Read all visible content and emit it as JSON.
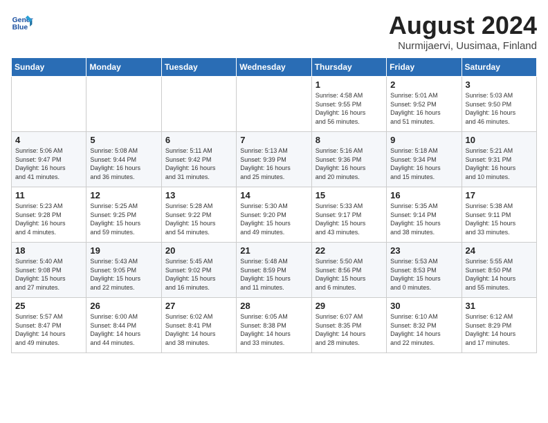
{
  "header": {
    "logo_line1": "General",
    "logo_line2": "Blue",
    "month": "August 2024",
    "location": "Nurmijaervi, Uusimaa, Finland"
  },
  "weekdays": [
    "Sunday",
    "Monday",
    "Tuesday",
    "Wednesday",
    "Thursday",
    "Friday",
    "Saturday"
  ],
  "weeks": [
    [
      {
        "day": "",
        "info": ""
      },
      {
        "day": "",
        "info": ""
      },
      {
        "day": "",
        "info": ""
      },
      {
        "day": "",
        "info": ""
      },
      {
        "day": "1",
        "info": "Sunrise: 4:58 AM\nSunset: 9:55 PM\nDaylight: 16 hours\nand 56 minutes."
      },
      {
        "day": "2",
        "info": "Sunrise: 5:01 AM\nSunset: 9:52 PM\nDaylight: 16 hours\nand 51 minutes."
      },
      {
        "day": "3",
        "info": "Sunrise: 5:03 AM\nSunset: 9:50 PM\nDaylight: 16 hours\nand 46 minutes."
      }
    ],
    [
      {
        "day": "4",
        "info": "Sunrise: 5:06 AM\nSunset: 9:47 PM\nDaylight: 16 hours\nand 41 minutes."
      },
      {
        "day": "5",
        "info": "Sunrise: 5:08 AM\nSunset: 9:44 PM\nDaylight: 16 hours\nand 36 minutes."
      },
      {
        "day": "6",
        "info": "Sunrise: 5:11 AM\nSunset: 9:42 PM\nDaylight: 16 hours\nand 31 minutes."
      },
      {
        "day": "7",
        "info": "Sunrise: 5:13 AM\nSunset: 9:39 PM\nDaylight: 16 hours\nand 25 minutes."
      },
      {
        "day": "8",
        "info": "Sunrise: 5:16 AM\nSunset: 9:36 PM\nDaylight: 16 hours\nand 20 minutes."
      },
      {
        "day": "9",
        "info": "Sunrise: 5:18 AM\nSunset: 9:34 PM\nDaylight: 16 hours\nand 15 minutes."
      },
      {
        "day": "10",
        "info": "Sunrise: 5:21 AM\nSunset: 9:31 PM\nDaylight: 16 hours\nand 10 minutes."
      }
    ],
    [
      {
        "day": "11",
        "info": "Sunrise: 5:23 AM\nSunset: 9:28 PM\nDaylight: 16 hours\nand 4 minutes."
      },
      {
        "day": "12",
        "info": "Sunrise: 5:25 AM\nSunset: 9:25 PM\nDaylight: 15 hours\nand 59 minutes."
      },
      {
        "day": "13",
        "info": "Sunrise: 5:28 AM\nSunset: 9:22 PM\nDaylight: 15 hours\nand 54 minutes."
      },
      {
        "day": "14",
        "info": "Sunrise: 5:30 AM\nSunset: 9:20 PM\nDaylight: 15 hours\nand 49 minutes."
      },
      {
        "day": "15",
        "info": "Sunrise: 5:33 AM\nSunset: 9:17 PM\nDaylight: 15 hours\nand 43 minutes."
      },
      {
        "day": "16",
        "info": "Sunrise: 5:35 AM\nSunset: 9:14 PM\nDaylight: 15 hours\nand 38 minutes."
      },
      {
        "day": "17",
        "info": "Sunrise: 5:38 AM\nSunset: 9:11 PM\nDaylight: 15 hours\nand 33 minutes."
      }
    ],
    [
      {
        "day": "18",
        "info": "Sunrise: 5:40 AM\nSunset: 9:08 PM\nDaylight: 15 hours\nand 27 minutes."
      },
      {
        "day": "19",
        "info": "Sunrise: 5:43 AM\nSunset: 9:05 PM\nDaylight: 15 hours\nand 22 minutes."
      },
      {
        "day": "20",
        "info": "Sunrise: 5:45 AM\nSunset: 9:02 PM\nDaylight: 15 hours\nand 16 minutes."
      },
      {
        "day": "21",
        "info": "Sunrise: 5:48 AM\nSunset: 8:59 PM\nDaylight: 15 hours\nand 11 minutes."
      },
      {
        "day": "22",
        "info": "Sunrise: 5:50 AM\nSunset: 8:56 PM\nDaylight: 15 hours\nand 6 minutes."
      },
      {
        "day": "23",
        "info": "Sunrise: 5:53 AM\nSunset: 8:53 PM\nDaylight: 15 hours\nand 0 minutes."
      },
      {
        "day": "24",
        "info": "Sunrise: 5:55 AM\nSunset: 8:50 PM\nDaylight: 14 hours\nand 55 minutes."
      }
    ],
    [
      {
        "day": "25",
        "info": "Sunrise: 5:57 AM\nSunset: 8:47 PM\nDaylight: 14 hours\nand 49 minutes."
      },
      {
        "day": "26",
        "info": "Sunrise: 6:00 AM\nSunset: 8:44 PM\nDaylight: 14 hours\nand 44 minutes."
      },
      {
        "day": "27",
        "info": "Sunrise: 6:02 AM\nSunset: 8:41 PM\nDaylight: 14 hours\nand 38 minutes."
      },
      {
        "day": "28",
        "info": "Sunrise: 6:05 AM\nSunset: 8:38 PM\nDaylight: 14 hours\nand 33 minutes."
      },
      {
        "day": "29",
        "info": "Sunrise: 6:07 AM\nSunset: 8:35 PM\nDaylight: 14 hours\nand 28 minutes."
      },
      {
        "day": "30",
        "info": "Sunrise: 6:10 AM\nSunset: 8:32 PM\nDaylight: 14 hours\nand 22 minutes."
      },
      {
        "day": "31",
        "info": "Sunrise: 6:12 AM\nSunset: 8:29 PM\nDaylight: 14 hours\nand 17 minutes."
      }
    ]
  ]
}
